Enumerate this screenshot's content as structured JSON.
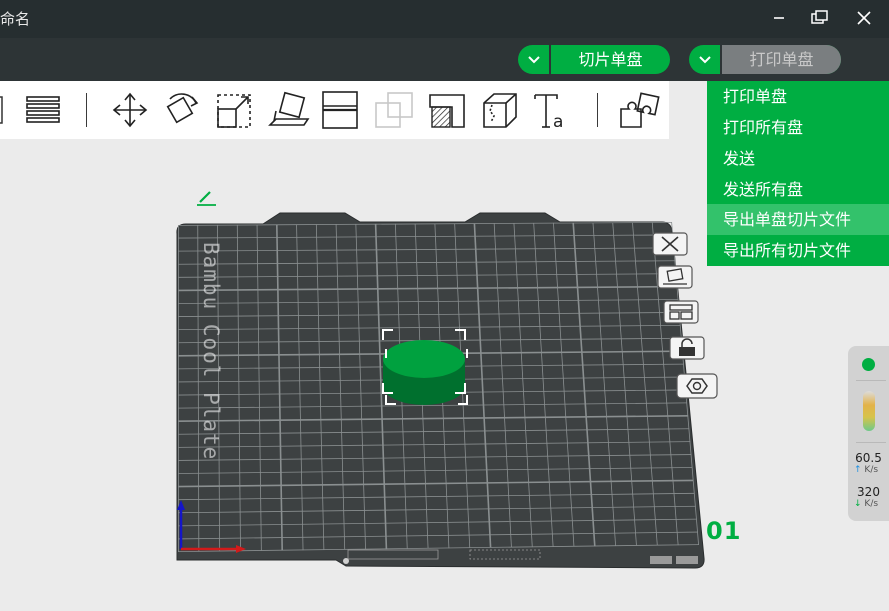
{
  "window": {
    "title": "命名"
  },
  "header": {
    "slice_label": "切片单盘",
    "print_label": "打印单盘"
  },
  "print_menu": {
    "items": [
      {
        "label": "打印单盘"
      },
      {
        "label": "打印所有盘"
      },
      {
        "label": "发送"
      },
      {
        "label": "发送所有盘"
      },
      {
        "label": "导出单盘切片文件"
      },
      {
        "label": "导出所有切片文件"
      }
    ],
    "hovered_index": 4
  },
  "plate": {
    "label": "Bambu Cool Plate",
    "number": "01"
  },
  "stats": {
    "up_value": "60.5",
    "up_unit": "K/s",
    "down_value": "320",
    "down_unit": "K/s"
  },
  "colors": {
    "accent": "#00ae42",
    "plate": "#3d4142",
    "topbar": "#2d3436",
    "titlebar": "#262e30"
  },
  "icons": [
    "layers-icon",
    "move-icon",
    "rotate-icon",
    "scale-icon",
    "lay-on-face-icon",
    "cut-icon",
    "boolean-icon",
    "support-paint-icon",
    "seam-paint-icon",
    "text-icon",
    "assembly-icon"
  ]
}
